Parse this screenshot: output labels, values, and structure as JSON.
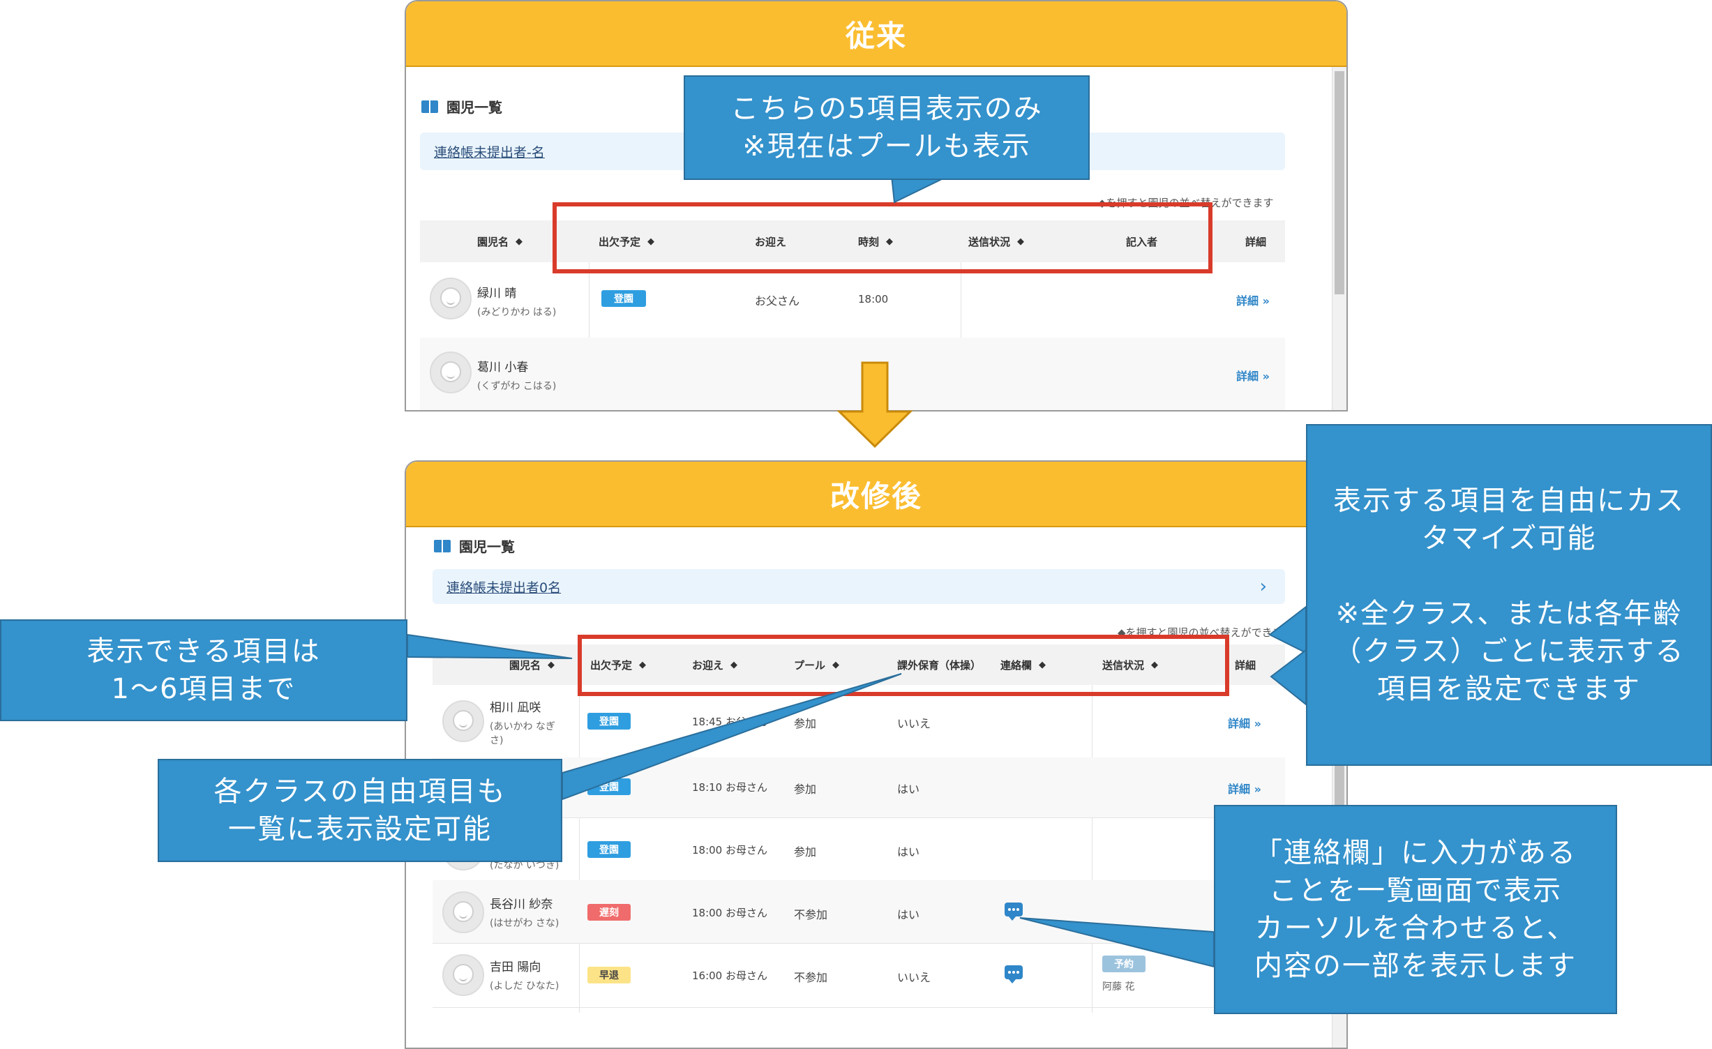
{
  "before": {
    "header": "従来",
    "section_title": "園児一覧",
    "notice": "連絡帳未提出者-名",
    "sort_hint": "◆を押すと園児の並べ替えができます",
    "columns": [
      "園児名",
      "出欠予定",
      "お迎え",
      "時刻",
      "送信状況",
      "記入者",
      "詳細"
    ],
    "rows": [
      {
        "name": "緑川 晴",
        "kana": "(みどりかわ はる)",
        "status": "登園",
        "pickup": "お父さん",
        "time": "18:00",
        "detail": "詳細 »"
      },
      {
        "name": "葛川 小春",
        "kana": "(くずがわ こはる)",
        "detail": "詳細 »"
      }
    ]
  },
  "after": {
    "header": "改修後",
    "section_title": "園児一覧",
    "notice": "連絡帳未提出者0名",
    "sort_hint": "◆を押すと園児の並べ替えができます",
    "columns": [
      "園児名",
      "出欠予定",
      "お迎え",
      "プール",
      "課外保育（体操）",
      "連絡欄",
      "送信状況",
      "詳細"
    ],
    "rows": [
      {
        "name": "相川 凪咲",
        "kana": "(あいかわ なぎさ)",
        "status": "登園",
        "time": "18:45",
        "pickup": "お父さん",
        "pool": "参加",
        "extra": "いいえ",
        "detail": "詳細 »"
      },
      {
        "status": "登園",
        "time": "18:10",
        "pickup": "お母さん",
        "pool": "参加",
        "extra": "はい",
        "detail": "詳細 »"
      },
      {
        "kana": "(たなか いつき)",
        "status": "登園",
        "time": "18:00",
        "pickup": "お母さん",
        "pool": "参加",
        "extra": "はい"
      },
      {
        "name": "長谷川 紗奈",
        "kana": "(はせがわ さな)",
        "status": "遅刻",
        "time": "18:00",
        "pickup": "お母さん",
        "pool": "不参加",
        "extra": "はい",
        "has_message": true
      },
      {
        "name": "吉田 陽向",
        "kana": "(よしだ ひなた)",
        "status": "早退",
        "time": "16:00",
        "pickup": "お母さん",
        "pool": "不参加",
        "extra": "いいえ",
        "has_message": true,
        "send_badge": "予約",
        "writer": "阿藤 花"
      }
    ]
  },
  "callouts": {
    "five_items": "こちらの5項目表示のみ\n※現在はプールも表示",
    "customize": "表示する項目を自由にカスタマイズ可能\n\n※全クラス、または各年齢（クラス）ごとに表示する項目を設定できます",
    "up_to_six": "表示できる項目は\n1〜6項目まで",
    "free_items": "各クラスの自由項目も\n一覧に表示設定可能",
    "message_field": "「連絡欄」に入力がある\nことを一覧画面で表示\nカーソルを合わせると、\n内容の一部を表示します"
  },
  "colors": {
    "header": "#fbbd30",
    "callout": "#3492cc",
    "highlight": "#d93b2b",
    "arrow": "#fbbd30"
  }
}
